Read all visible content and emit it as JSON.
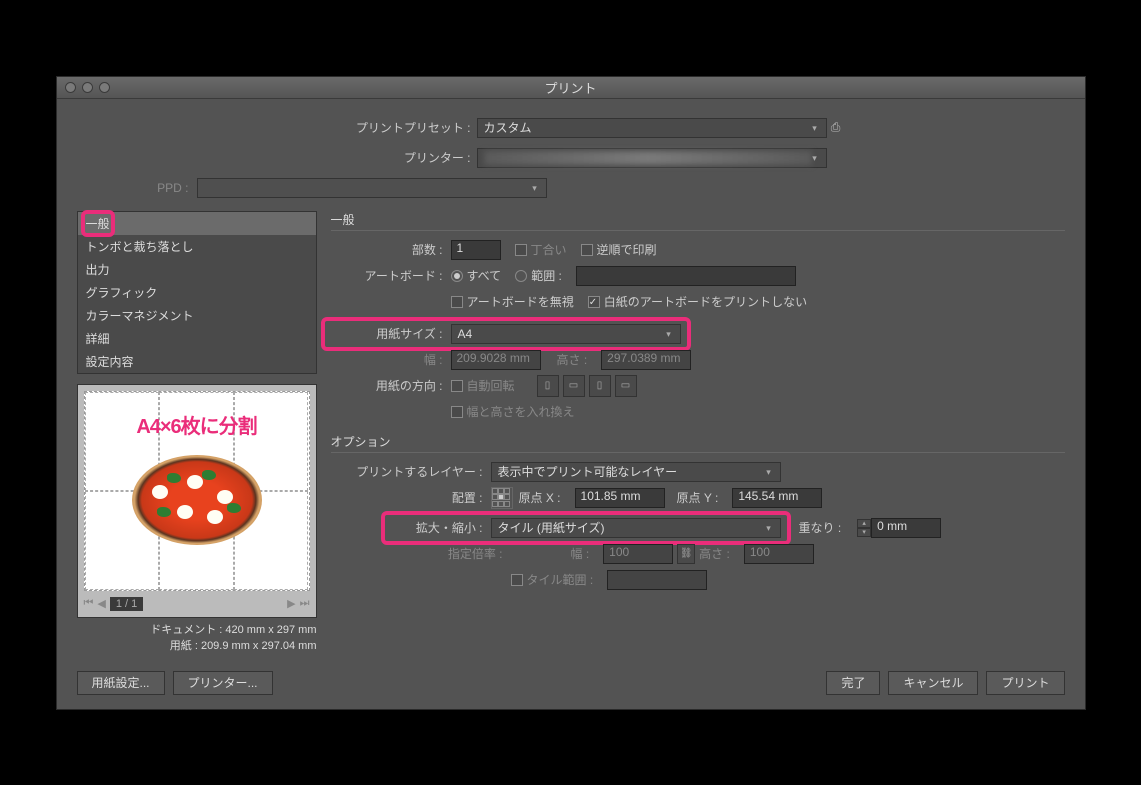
{
  "title": "プリント",
  "top": {
    "preset_label": "プリントプリセット :",
    "preset_value": "カスタム",
    "printer_label": "プリンター :",
    "ppd_label": "PPD :"
  },
  "cats": [
    "一般",
    "トンボと裁ち落とし",
    "出力",
    "グラフィック",
    "カラーマネジメント",
    "詳細",
    "設定内容"
  ],
  "annot": "A4×6枚に分割",
  "nav_page": "1 / 1",
  "docinfo1": "ドキュメント : 420 mm x 297 mm",
  "docinfo2": "用紙 : 209.9 mm x 297.04 mm",
  "sec_general": "一般",
  "copies_label": "部数 :",
  "copies_val": "1",
  "collate": "丁合い",
  "reverse": "逆順で印刷",
  "artboard_label": "アートボード :",
  "all": "すべて",
  "range": "範囲 :",
  "ignore_ab": "アートボードを無視",
  "skip_blank": "白紙のアートボードをプリントしない",
  "paper_size_label": "用紙サイズ :",
  "paper_size_val": "A4",
  "width_label": "幅 :",
  "width_val": "209.9028 mm",
  "height_label": "高さ :",
  "height_val": "297.0389 mm",
  "orient_label": "用紙の方向 :",
  "auto_rotate": "自動回転",
  "swap_wh": "幅と高さを入れ換え",
  "sec_options": "オプション",
  "layers_label": "プリントするレイヤー :",
  "layers_val": "表示中でプリント可能なレイヤー",
  "placement_label": "配置 :",
  "originx": "原点 X :",
  "originx_val": "101.85 mm",
  "originy": "原点 Y :",
  "originy_val": "145.54 mm",
  "scale_label": "拡大・縮小 :",
  "scale_val": "タイル (用紙サイズ)",
  "overlap_label": "重なり :",
  "overlap_val": "0 mm",
  "ratio_label": "指定倍率 :",
  "sw_label": "幅 :",
  "sw_val": "100",
  "sh_label": "高さ :",
  "sh_val": "100",
  "tile_range": "タイル範囲 :",
  "btn_page_setup": "用紙設定...",
  "btn_printer": "プリンター...",
  "btn_done": "完了",
  "btn_cancel": "キャンセル",
  "btn_print": "プリント"
}
